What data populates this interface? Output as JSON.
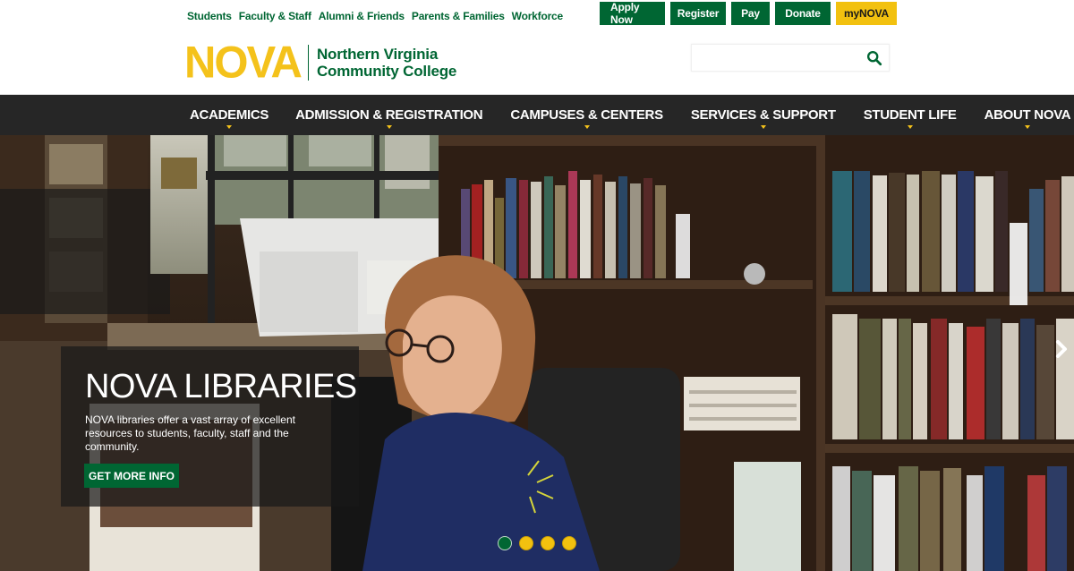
{
  "utility_links": [
    "Students",
    "Faculty & Staff",
    "Alumni & Friends",
    "Parents & Families",
    "Workforce"
  ],
  "cta_buttons": [
    "Apply Now",
    "Register",
    "Pay",
    "Donate",
    "myNOVA"
  ],
  "logo": {
    "wordmark": "NOVA",
    "name_line1": "Northern Virginia",
    "name_line2": "Community College"
  },
  "search": {
    "placeholder": "",
    "icon": "search-icon"
  },
  "nav": {
    "items": [
      "ACADEMICS",
      "ADMISSION & REGISTRATION",
      "CAMPUSES & CENTERS",
      "SERVICES & SUPPORT",
      "STUDENT LIFE",
      "ABOUT NOVA"
    ]
  },
  "hero": {
    "title": "NOVA LIBRARIES",
    "text": "NOVA libraries offer a vast array of excellent resources to students, faculty, staff and the community.",
    "cta_label": "GET MORE INFO",
    "slide_dots": 4,
    "active_dot": 1
  },
  "colors": {
    "brand_green": "#006633",
    "brand_gold": "#f4c21b",
    "nav_bg": "#262626"
  }
}
